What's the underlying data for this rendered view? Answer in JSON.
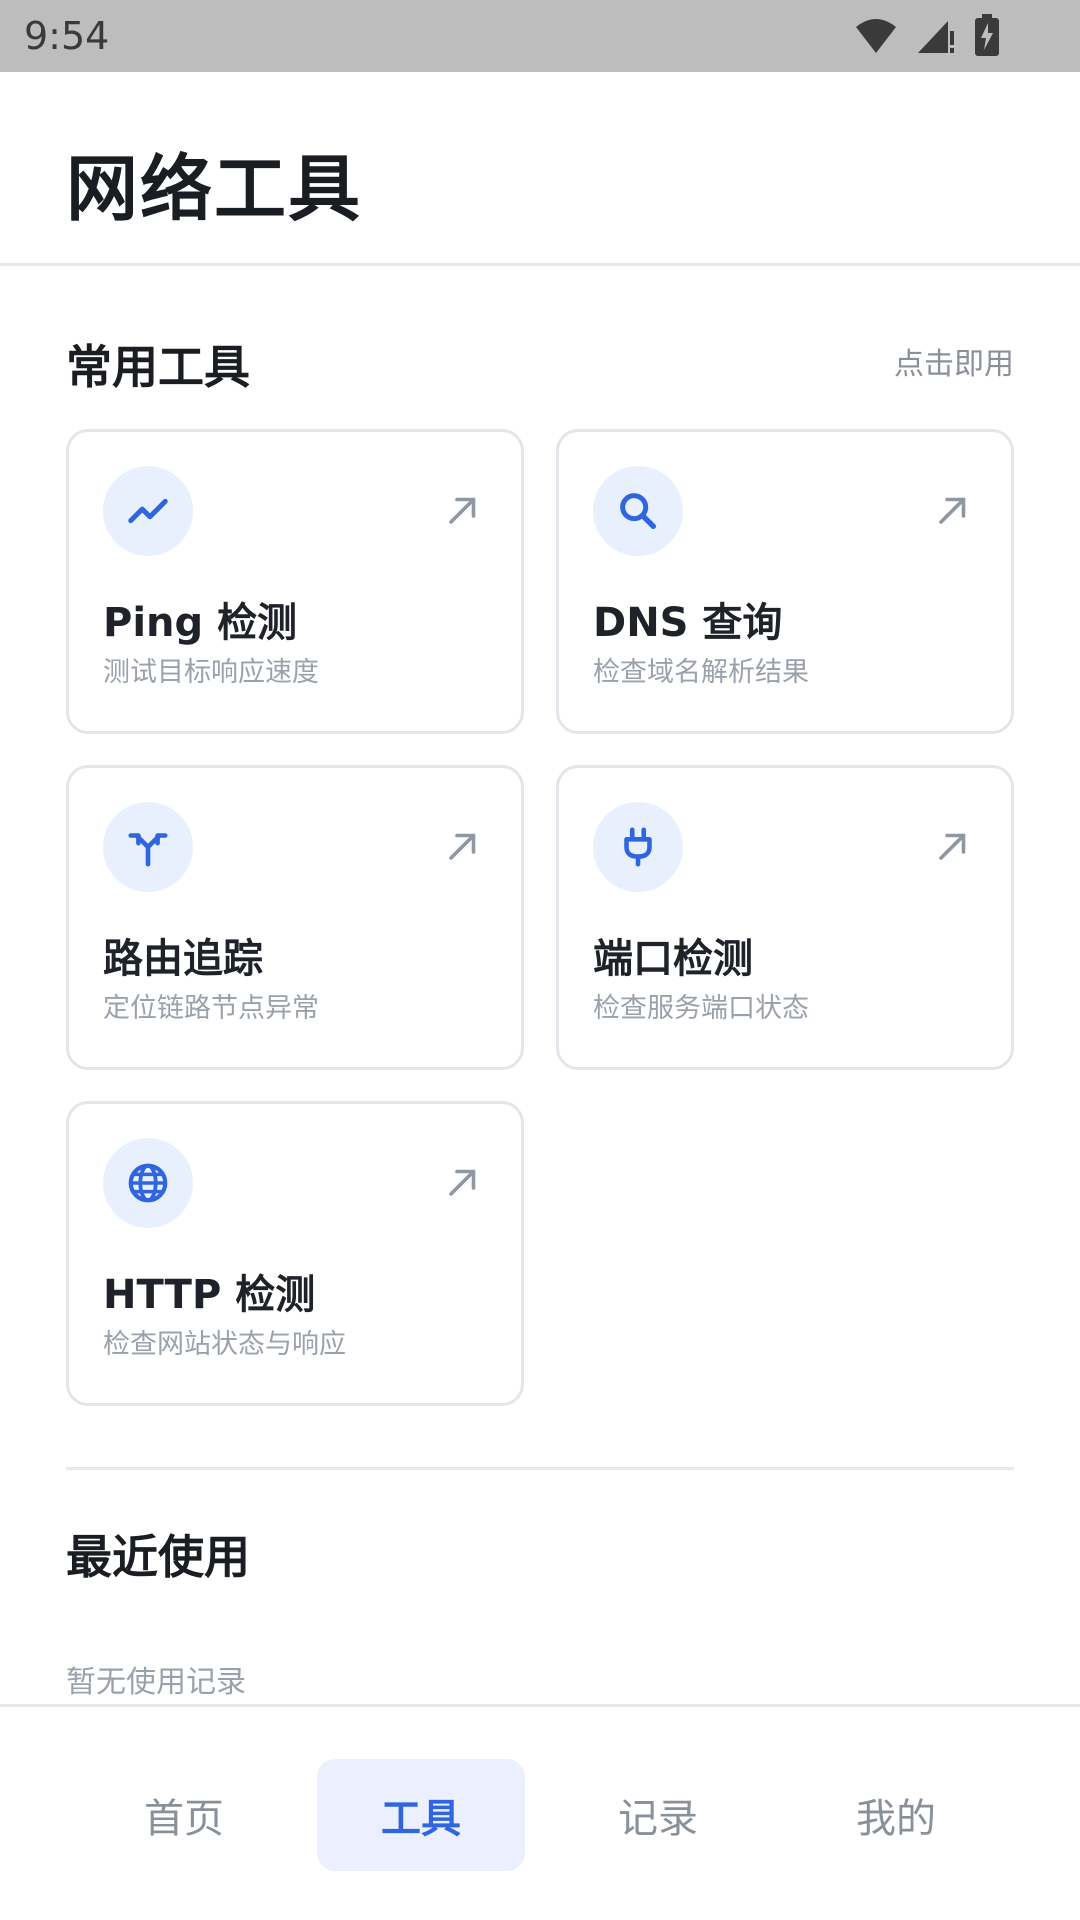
{
  "status": {
    "time": "9:54",
    "icons": [
      "wifi-icon",
      "signal-icon",
      "battery-charging-icon"
    ]
  },
  "header": {
    "title": "网络工具"
  },
  "common_tools": {
    "title": "常用工具",
    "hint": "点击即用",
    "items": [
      {
        "name": "Ping 检测",
        "desc": "测试目标响应速度",
        "icon": "trend-icon"
      },
      {
        "name": "DNS 查询",
        "desc": "检查域名解析结果",
        "icon": "search-icon"
      },
      {
        "name": "路由追踪",
        "desc": "定位链路节点异常",
        "icon": "route-fork-icon"
      },
      {
        "name": "端口检测",
        "desc": "检查服务端口状态",
        "icon": "plug-icon"
      },
      {
        "name": "HTTP 检测",
        "desc": "检查网站状态与响应",
        "icon": "globe-icon"
      }
    ]
  },
  "recent": {
    "title": "最近使用",
    "empty": "暂无使用记录"
  },
  "nav": {
    "items": [
      {
        "label": "首页",
        "active": false
      },
      {
        "label": "工具",
        "active": true
      },
      {
        "label": "记录",
        "active": false
      },
      {
        "label": "我的",
        "active": false
      }
    ]
  },
  "colors": {
    "accent": "#2f66e0",
    "icon_bg": "#e8effd",
    "nav_active_bg": "#eceffd"
  }
}
